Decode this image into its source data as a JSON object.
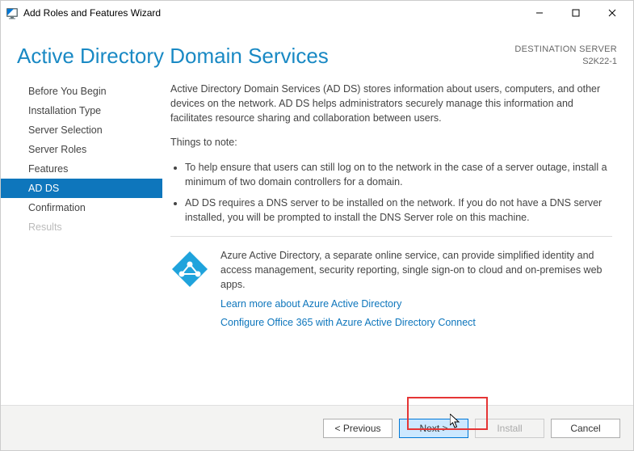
{
  "window": {
    "title": "Add Roles and Features Wizard"
  },
  "header": {
    "title": "Active Directory Domain Services",
    "destination_label": "DESTINATION SERVER",
    "destination_name": "S2K22-1"
  },
  "sidebar": {
    "items": [
      {
        "label": "Before You Begin",
        "selected": false,
        "disabled": false
      },
      {
        "label": "Installation Type",
        "selected": false,
        "disabled": false
      },
      {
        "label": "Server Selection",
        "selected": false,
        "disabled": false
      },
      {
        "label": "Server Roles",
        "selected": false,
        "disabled": false
      },
      {
        "label": "Features",
        "selected": false,
        "disabled": false
      },
      {
        "label": "AD DS",
        "selected": true,
        "disabled": false
      },
      {
        "label": "Confirmation",
        "selected": false,
        "disabled": false
      },
      {
        "label": "Results",
        "selected": false,
        "disabled": true
      }
    ]
  },
  "content": {
    "intro": "Active Directory Domain Services (AD DS) stores information about users, computers, and other devices on the network.  AD DS helps administrators securely manage this information and facilitates resource sharing and collaboration between users.",
    "notes_heading": "Things to note:",
    "notes": [
      "To help ensure that users can still log on to the network in the case of a server outage, install a minimum of two domain controllers for a domain.",
      "AD DS requires a DNS server to be installed on the network.  If you do not have a DNS server installed, you will be prompted to install the DNS Server role on this machine."
    ],
    "azure": {
      "text": "Azure Active Directory, a separate online service, can provide simplified identity and access management, security reporting, single sign-on to cloud and on-premises web apps.",
      "link1": "Learn more about Azure Active Directory",
      "link2": "Configure Office 365 with Azure Active Directory Connect"
    }
  },
  "footer": {
    "previous": "< Previous",
    "next": "Next >",
    "install": "Install",
    "cancel": "Cancel"
  }
}
